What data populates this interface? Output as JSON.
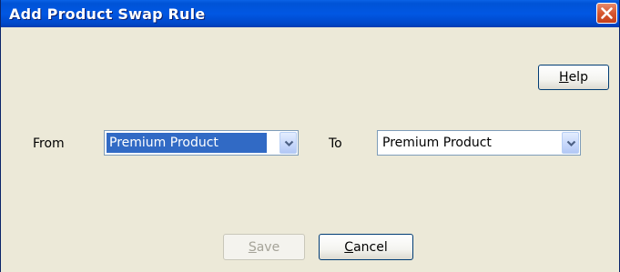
{
  "window": {
    "title": "Add Product Swap Rule"
  },
  "toolbar": {
    "help_first": "H",
    "help_rest": "elp"
  },
  "form": {
    "from_label": "From",
    "from_value": "Premium Product",
    "to_label": "To",
    "to_value": "Premium Product"
  },
  "footer": {
    "save_first": "S",
    "save_rest": "ave",
    "save_enabled": false,
    "cancel_first": "C",
    "cancel_rest": "ancel"
  },
  "icons": {
    "close": "close-icon",
    "dropdown": "chevron-down-icon"
  },
  "colors": {
    "titlebar": "#0157e3",
    "dialog_bg": "#ece9d8",
    "close_button": "#d6562f",
    "selection": "#316ac5",
    "disabled_text": "#a5a398"
  }
}
